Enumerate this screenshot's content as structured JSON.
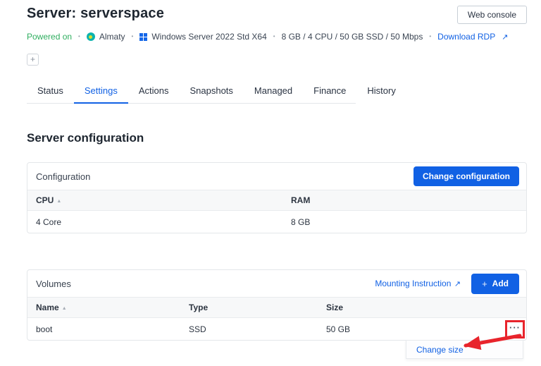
{
  "page": {
    "title": "Server: serverspace",
    "web_console_label": "Web console"
  },
  "status_bar": {
    "power_state": "Powered on",
    "separator": "•",
    "location": "Almaty",
    "os": "Windows Server 2022 Std X64",
    "specs": "8 GB / 4 CPU / 50 GB SSD / 50 Mbps",
    "download_rdp_label": "Download RDP",
    "external_arrow": "↗"
  },
  "add_tag_label": "+",
  "tabs": {
    "items": [
      "Status",
      "Settings",
      "Actions",
      "Snapshots",
      "Managed",
      "Finance",
      "History"
    ],
    "active": "Settings"
  },
  "section_title": "Server configuration",
  "configuration_card": {
    "title": "Configuration",
    "change_button_label": "Change configuration",
    "sort_arrow": "▲",
    "columns": [
      "CPU",
      "RAM"
    ],
    "row": {
      "cpu": "4 Core",
      "ram": "8 GB"
    }
  },
  "volumes_card": {
    "title": "Volumes",
    "mounting_link_label": "Mounting Instruction",
    "external_arrow": "↗",
    "add_plus": "+",
    "add_button_label": "Add",
    "sort_arrow": "▲",
    "columns": [
      "Name",
      "Type",
      "Size"
    ],
    "row": {
      "name": "boot",
      "type": "SSD",
      "size": "50 GB"
    },
    "menu_icon": "···",
    "dropdown_item": "Change size"
  },
  "colors": {
    "accent": "#1161e4",
    "green": "#2fae5f",
    "annotation_red": "#e8242c"
  }
}
